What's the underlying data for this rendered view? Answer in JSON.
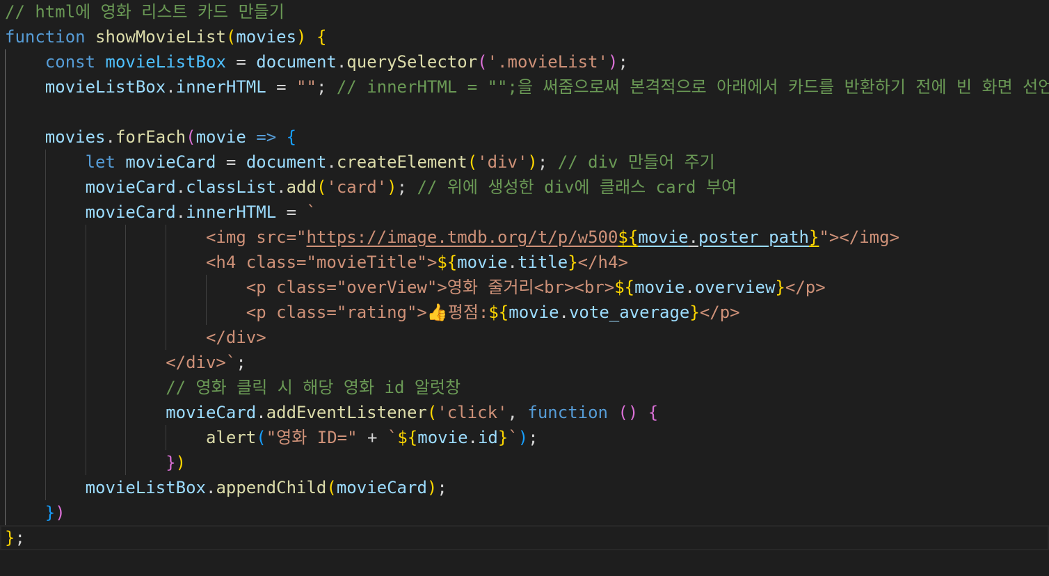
{
  "editor": {
    "language": "javascript",
    "current_line": 22,
    "colors": {
      "background": "#1e1e1e",
      "keyword": "#569cd6",
      "function": "#dcdcaa",
      "variable": "#9cdcfe",
      "constant": "#4fc1ff",
      "string": "#ce9178",
      "comment": "#6a9955",
      "bracket1": "#ffd700",
      "bracket2": "#da70d6",
      "bracket3": "#179fff"
    },
    "lines": [
      [
        [
          "// html에 영화 리스트 카드 만들기",
          "cmt"
        ]
      ],
      [
        [
          "function",
          "kw"
        ],
        [
          " ",
          "pun"
        ],
        [
          "showMovieList",
          "fn"
        ],
        [
          "(",
          "br1"
        ],
        [
          "movies",
          "var"
        ],
        [
          ")",
          "br1"
        ],
        [
          " ",
          "pun"
        ],
        [
          "{",
          "br1"
        ]
      ],
      [
        [
          "    ",
          "pun"
        ],
        [
          "const",
          "kw"
        ],
        [
          " ",
          "pun"
        ],
        [
          "movieListBox",
          "cst"
        ],
        [
          " = ",
          "pun"
        ],
        [
          "document",
          "var"
        ],
        [
          ".",
          "pun"
        ],
        [
          "querySelector",
          "fn"
        ],
        [
          "(",
          "br2"
        ],
        [
          "'.movieList'",
          "str"
        ],
        [
          ")",
          "br2"
        ],
        [
          ";",
          "pun"
        ]
      ],
      [
        [
          "    ",
          "pun"
        ],
        [
          "movieListBox",
          "var"
        ],
        [
          ".",
          "pun"
        ],
        [
          "innerHTML",
          "var"
        ],
        [
          " = ",
          "pun"
        ],
        [
          "\"\"",
          "str"
        ],
        [
          "; ",
          "pun"
        ],
        [
          "// innerHTML = \"\";을 써줌으로써 본격적으로 아래에서 카드를 반환하기 전에 빈 화면 선언",
          "cmt"
        ]
      ],
      [
        [
          "    ",
          "pun"
        ]
      ],
      [
        [
          "    ",
          "pun"
        ],
        [
          "movies",
          "var"
        ],
        [
          ".",
          "pun"
        ],
        [
          "forEach",
          "fn"
        ],
        [
          "(",
          "br2"
        ],
        [
          "movie",
          "var"
        ],
        [
          " ",
          "pun"
        ],
        [
          "=>",
          "kw"
        ],
        [
          " ",
          "pun"
        ],
        [
          "{",
          "br3"
        ]
      ],
      [
        [
          "        ",
          "pun"
        ],
        [
          "let",
          "kw"
        ],
        [
          " ",
          "pun"
        ],
        [
          "movieCard",
          "var"
        ],
        [
          " = ",
          "pun"
        ],
        [
          "document",
          "var"
        ],
        [
          ".",
          "pun"
        ],
        [
          "createElement",
          "fn"
        ],
        [
          "(",
          "br1"
        ],
        [
          "'div'",
          "str"
        ],
        [
          ")",
          "br1"
        ],
        [
          "; ",
          "pun"
        ],
        [
          "// div 만들어 주기",
          "cmt"
        ]
      ],
      [
        [
          "        ",
          "pun"
        ],
        [
          "movieCard",
          "var"
        ],
        [
          ".",
          "pun"
        ],
        [
          "classList",
          "var"
        ],
        [
          ".",
          "pun"
        ],
        [
          "add",
          "fn"
        ],
        [
          "(",
          "br1"
        ],
        [
          "'card'",
          "str"
        ],
        [
          ")",
          "br1"
        ],
        [
          "; ",
          "pun"
        ],
        [
          "// 위에 생성한 div에 클래스 card 부여",
          "cmt"
        ]
      ],
      [
        [
          "        ",
          "pun"
        ],
        [
          "movieCard",
          "var"
        ],
        [
          ".",
          "pun"
        ],
        [
          "innerHTML",
          "var"
        ],
        [
          " = ",
          "pun"
        ],
        [
          "`",
          "str"
        ]
      ],
      [
        [
          "                    ",
          "pun"
        ],
        [
          "<img src=\"",
          "str"
        ],
        [
          "https://image.tmdb.org/t/p/w500",
          "str ul"
        ],
        [
          "${",
          "br1 ul"
        ],
        [
          "movie",
          "var ul"
        ],
        [
          ".",
          "pun ul"
        ],
        [
          "poster_path",
          "var ul"
        ],
        [
          "}",
          "br1 ul"
        ],
        [
          "\"></img>",
          "str"
        ]
      ],
      [
        [
          "                    ",
          "pun"
        ],
        [
          "<h4 class=\"movieTitle\">",
          "str"
        ],
        [
          "${",
          "br1"
        ],
        [
          "movie",
          "var"
        ],
        [
          ".",
          "pun"
        ],
        [
          "title",
          "var"
        ],
        [
          "}",
          "br1"
        ],
        [
          "</h4>",
          "str"
        ]
      ],
      [
        [
          "                        ",
          "pun"
        ],
        [
          "<p class=\"overView\">영화 줄거리<br><br>",
          "str"
        ],
        [
          "${",
          "br1"
        ],
        [
          "movie",
          "var"
        ],
        [
          ".",
          "pun"
        ],
        [
          "overview",
          "var"
        ],
        [
          "}",
          "br1"
        ],
        [
          "</p>",
          "str"
        ]
      ],
      [
        [
          "                        ",
          "pun"
        ],
        [
          "<p class=\"rating\">👍평점:",
          "str"
        ],
        [
          "${",
          "br1"
        ],
        [
          "movie",
          "var"
        ],
        [
          ".",
          "pun"
        ],
        [
          "vote_average",
          "var"
        ],
        [
          "}",
          "br1"
        ],
        [
          "</p>",
          "str"
        ]
      ],
      [
        [
          "                    ",
          "pun"
        ],
        [
          "</div>",
          "str"
        ]
      ],
      [
        [
          "                ",
          "pun"
        ],
        [
          "</div>`",
          "str"
        ],
        [
          ";",
          "pun"
        ]
      ],
      [
        [
          "                ",
          "pun"
        ],
        [
          "// 영화 클릭 시 해당 영화 id 알럿창",
          "cmt"
        ]
      ],
      [
        [
          "                ",
          "pun"
        ],
        [
          "movieCard",
          "var"
        ],
        [
          ".",
          "pun"
        ],
        [
          "addEventListener",
          "fn"
        ],
        [
          "(",
          "br1"
        ],
        [
          "'click'",
          "str"
        ],
        [
          ", ",
          "pun"
        ],
        [
          "function",
          "kw"
        ],
        [
          " ",
          "pun"
        ],
        [
          "()",
          "br2"
        ],
        [
          " ",
          "pun"
        ],
        [
          "{",
          "br2"
        ]
      ],
      [
        [
          "                    ",
          "pun"
        ],
        [
          "alert",
          "fn"
        ],
        [
          "(",
          "br3"
        ],
        [
          "\"영화 ID=\"",
          "str"
        ],
        [
          " + ",
          "pun"
        ],
        [
          "`",
          "str"
        ],
        [
          "${",
          "br1"
        ],
        [
          "movie",
          "var"
        ],
        [
          ".",
          "pun"
        ],
        [
          "id",
          "var"
        ],
        [
          "}",
          "br1"
        ],
        [
          "`",
          "str"
        ],
        [
          ")",
          "br3"
        ],
        [
          ";",
          "pun"
        ]
      ],
      [
        [
          "                ",
          "pun"
        ],
        [
          "}",
          "br2"
        ],
        [
          ")",
          "br1"
        ]
      ],
      [
        [
          "        ",
          "pun"
        ],
        [
          "movieListBox",
          "var"
        ],
        [
          ".",
          "pun"
        ],
        [
          "appendChild",
          "fn"
        ],
        [
          "(",
          "br1"
        ],
        [
          "movieCard",
          "var"
        ],
        [
          ")",
          "br1"
        ],
        [
          ";",
          "pun"
        ]
      ],
      [
        [
          "    ",
          "pun"
        ],
        [
          "}",
          "br3"
        ],
        [
          ")",
          "br2"
        ]
      ],
      [
        [
          "}",
          "br1"
        ],
        [
          ";",
          "pun"
        ]
      ]
    ]
  }
}
